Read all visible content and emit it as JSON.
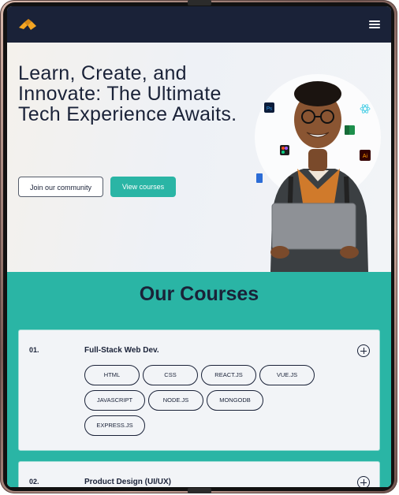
{
  "header": {
    "menu_icon": "hamburger-menu-icon",
    "logo_icon": "brand-logo-icon"
  },
  "hero": {
    "title": "Learn, Create, and Innovate: The Ultimate Tech Experience Awaits.",
    "secondary_button": "Join our community",
    "primary_button": "View courses",
    "illustration_icons": [
      "photoshop-icon",
      "react-icon",
      "excel-icon",
      "figma-icon",
      "illustrator-icon",
      "word-icon"
    ]
  },
  "courses": {
    "title": "Our Courses",
    "items": [
      {
        "number": "01.",
        "name": "Full-Stack Web Dev.",
        "tags": [
          "HTML",
          "CSS",
          "REACT.JS",
          "VUE.JS",
          "JAVASCRIPT",
          "NODE.JS",
          "MONGODB",
          "EXPRESS.JS"
        ]
      },
      {
        "number": "02.",
        "name": "Product Design (UI/UX)",
        "tags": []
      }
    ]
  },
  "colors": {
    "navy": "#1a2238",
    "teal": "#2ab5a5",
    "page": "#f2f4f7",
    "logo_orange": "#f5a623"
  }
}
